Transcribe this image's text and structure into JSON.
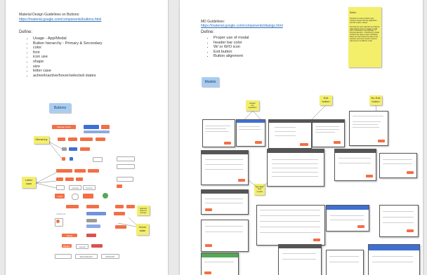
{
  "left_page": {
    "title": "Material Design Guidelines on Buttons:",
    "url": "https://material.google.com/components/buttons.html",
    "define_label": "Define:",
    "define_items": [
      "Usage - App/Modal",
      "Button hierarchy - Primary & Secondary",
      "color",
      "font",
      "icon use",
      "shape",
      "size",
      "letter case",
      "active/inactive/hover/selected states"
    ],
    "section_tag": "Buttons",
    "stickies": {
      "hierarchy": "Hierarchy",
      "letter_case": "Letter\ncase",
      "hover_state": "Hover\nstate",
      "selected": "Selected\nbutton is\nprimary"
    },
    "button_labels": {
      "manage": "Manage Users",
      "secondary": "SECONDARY",
      "primary": "PRIMARY",
      "add": "+ ADD",
      "reset": "RESET",
      "delete": "Delete",
      "cancel": "Cancel",
      "remove": "REMOVE",
      "upload": "Upload",
      "confirm": "Confirm"
    }
  },
  "right_page": {
    "title": "MD Guidelines:",
    "url": "https://material.google.com/components/dialogs.html",
    "define_label": "Define:",
    "define_items": [
      "Proper use of modal",
      "header bar color",
      "W/ or W/O icon",
      "Exit button",
      "Button alignment"
    ],
    "note_title": "Notes:",
    "note_body": "Introduce a mode in which users continue interact with the application until the mode is closed.\n\nInterrupt the user's attention and halt all other actions until a message is dealt with or dismissed. Use sparingly - if focusing attention - introducing a modal window may cause a loss of workflow where the user forgets the state of the interface and how to perform actions discovered in a different mode.",
    "section_tag": "Models",
    "stickies": {
      "header": "Header\nw/o\nseparation",
      "exit": "Exit\nbutton",
      "no_exit": "No Exit\nbutton",
      "scrolling": "Scrolling\nin a\nmodal"
    }
  },
  "colors": {
    "orange": "#f36f45",
    "blue": "#3f6fd1",
    "green": "#56a756",
    "sticky": "#f4ef6b",
    "tag": "#a9cdf0"
  }
}
